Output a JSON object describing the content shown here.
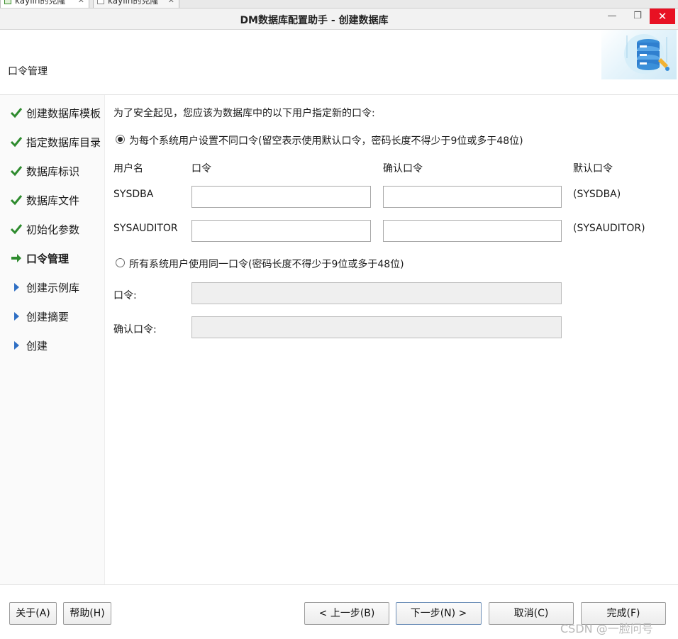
{
  "tabs": [
    {
      "label": "kaylin的克隆"
    },
    {
      "label": "kaylin的克隆"
    }
  ],
  "window": {
    "title": "DM数据库配置助手 - 创建数据库",
    "min_glyph": "—",
    "max_glyph": "❐",
    "close_glyph": "✕"
  },
  "header": {
    "page_title": "口令管理"
  },
  "steps": [
    {
      "label": "创建数据库模板",
      "status": "done"
    },
    {
      "label": "指定数据库目录",
      "status": "done"
    },
    {
      "label": "数据库标识",
      "status": "done"
    },
    {
      "label": "数据库文件",
      "status": "done"
    },
    {
      "label": "初始化参数",
      "status": "done"
    },
    {
      "label": "口令管理",
      "status": "current"
    },
    {
      "label": "创建示例库",
      "status": "pending"
    },
    {
      "label": "创建摘要",
      "status": "pending"
    },
    {
      "label": "创建",
      "status": "pending"
    }
  ],
  "colors": {
    "done": "#2e8b2e",
    "current": "#2e8b2e",
    "pending": "#2f6fc4"
  },
  "form": {
    "intro": "为了安全起见，您应该为数据库中的以下用户指定新的口令:",
    "option_separate": "为每个系统用户设置不同口令(留空表示使用默认口令，密码长度不得少于9位或多于48位)",
    "columns": {
      "user": "用户名",
      "password": "口令",
      "confirm": "确认口令",
      "default": "默认口令"
    },
    "users": [
      {
        "name": "SYSDBA",
        "password": "",
        "confirm": "",
        "default": "(SYSDBA)"
      },
      {
        "name": "SYSAUDITOR",
        "password": "",
        "confirm": "",
        "default": "(SYSAUDITOR)"
      }
    ],
    "option_same": "所有系统用户使用同一口令(密码长度不得少于9位或多于48位)",
    "same_password_label": "口令:",
    "same_password_value": "",
    "same_confirm_label": "确认口令:",
    "same_confirm_value": ""
  },
  "footer": {
    "about": "关于(A)",
    "help": "帮助(H)",
    "prev": "< 上一步(B)",
    "next": "下一步(N) >",
    "cancel": "取消(C)",
    "finish": "完成(F)",
    "watermark": "CSDN @一脸问号"
  }
}
